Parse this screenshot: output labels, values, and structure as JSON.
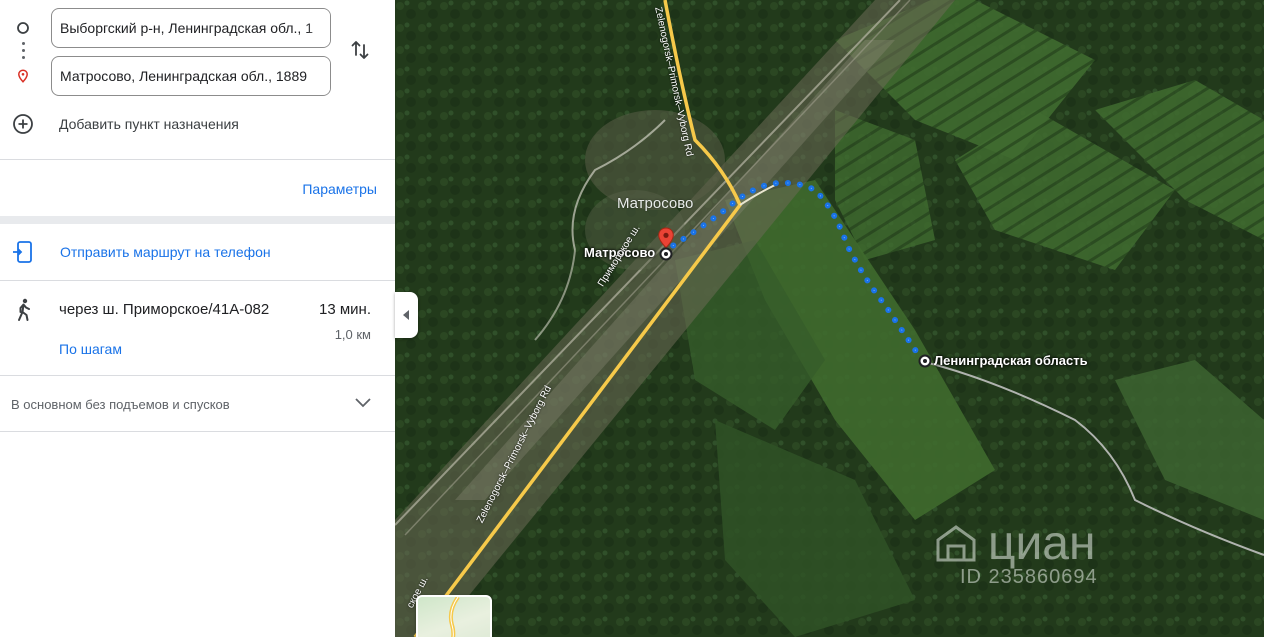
{
  "directions": {
    "origin_value": "Выборгский р-н, Ленинградская обл., 1",
    "destination_value": "Матросово, Ленинградская обл., 1889",
    "add_destination_label": "Добавить пункт назначения",
    "options_label": "Параметры",
    "send_to_phone_label": "Отправить маршрут на телефон"
  },
  "route": {
    "via": "через ш. Приморское/41А-082",
    "duration": "13 мин.",
    "distance": "1,0 км",
    "steps_label": "По шагам",
    "elevation_summary": "В основном без подъемов и спусков"
  },
  "map": {
    "town_label": "Матросово",
    "start_label": "Матросово",
    "end_label": "Ленинградская область",
    "road_labels": [
      "Приморское ш.",
      "Zelenogorsk–Primorsk–Vyborg Rd",
      "Zelenogorsk–Primorsk–Vyborg Rd",
      "ское ш."
    ],
    "watermark_brand": "циан",
    "watermark_id": "ID 235860694",
    "route_color": "#1a73e8",
    "road_color": "#f6c94a"
  },
  "icons": {
    "origin": "circle-icon",
    "destination": "location-pin-icon",
    "swap": "swap-vertical-icon",
    "add": "add-circle-icon",
    "send": "phone-send-icon",
    "mode": "walking-icon",
    "expand": "chevron-down-icon",
    "collapse": "chevron-left-icon"
  }
}
